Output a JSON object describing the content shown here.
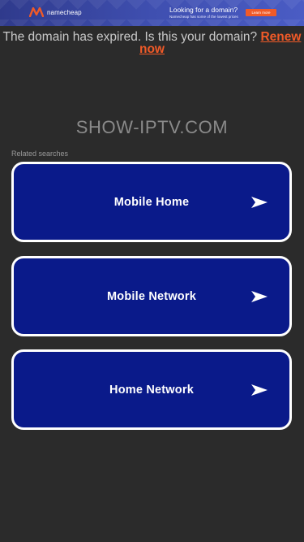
{
  "banner": {
    "brand": "namecheap",
    "headline": "Looking for a domain?",
    "subline": "Namecheap has some of the lowest prices",
    "cta_label": "Learn more",
    "brand_color": "#f05a28",
    "icon": "namecheap-logo-icon"
  },
  "notice": {
    "text": "The domain has expired. Is this your domain?",
    "link_label": "Renew now",
    "link_color": "#f05a28"
  },
  "site": {
    "domain": "SHOW-IPTV.COM"
  },
  "related": {
    "label": "Related searches",
    "items": [
      {
        "label": "Mobile Home",
        "icon": "arrow-right-icon"
      },
      {
        "label": "Mobile Network",
        "icon": "arrow-right-icon"
      },
      {
        "label": "Home Network",
        "icon": "arrow-right-icon"
      }
    ]
  },
  "colors": {
    "background": "#2b2b2b",
    "card_fill": "#0a1a8a",
    "card_border": "#ffffff"
  }
}
